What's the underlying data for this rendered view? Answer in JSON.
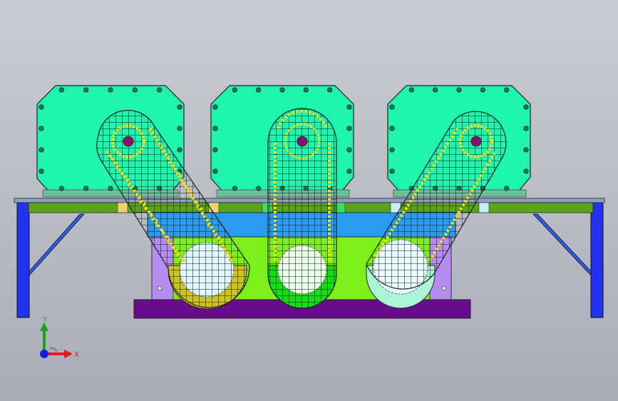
{
  "window": {
    "title": ""
  },
  "colors": {
    "background_top": "#c9ccd3",
    "background_bottom": "#a8adb8",
    "housing": "#1ff5ae",
    "frame_blue": "#2233ee",
    "rail_green": "#5aa31a",
    "base_purple": "#6a0a8c",
    "side_lavender": "#b58cf0",
    "bath_green": "#7df01a",
    "tank_blue": "#2a9cf0",
    "guard_olive": "#c9c421",
    "guard_green": "#14dd14",
    "guard_mint": "#aaf5d5",
    "chain_yellow": "#f2e11a",
    "sprocket_magenta": "#8a1070"
  },
  "triad": {
    "x_label": "X",
    "y_label": "Y",
    "x_color": "#e31a1a",
    "y_color": "#1aa31a",
    "z_color": "#1a1ae3"
  },
  "assemblies": [
    {
      "name": "left-drive",
      "guard_color": "olive",
      "sprocket_icon": "sprocket-icon"
    },
    {
      "name": "center-drive",
      "guard_color": "green",
      "sprocket_icon": "sprocket-icon"
    },
    {
      "name": "right-drive",
      "guard_color": "mint",
      "sprocket_icon": "sprocket-icon"
    }
  ]
}
